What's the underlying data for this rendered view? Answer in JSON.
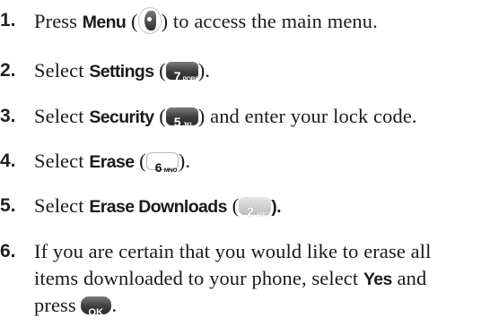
{
  "steps": [
    {
      "number": "1.",
      "before": "Press ",
      "keyword": "Menu",
      "open": " (",
      "close": ") to access the main menu.",
      "icon": "menu-key-icon"
    },
    {
      "number": "2.",
      "before": "Select ",
      "keyword": "Settings",
      "open": " (",
      "close": ").",
      "icon": "key-7-icon",
      "key_digit": "7",
      "key_letters": "PQRS"
    },
    {
      "number": "3.",
      "before": "Select ",
      "keyword": "Security",
      "open": " (",
      "close": ") and enter your lock code.",
      "icon": "key-5-icon",
      "key_digit": "5",
      "key_letters": "JKL"
    },
    {
      "number": "4.",
      "before": "Select ",
      "keyword": "Erase",
      "open": " (",
      "close": ").",
      "icon": "key-6-icon",
      "key_digit": "6",
      "key_letters": "MNO"
    },
    {
      "number": "5.",
      "before": "Select ",
      "keyword": "Erase Downloads",
      "open": " (",
      "close": ").",
      "icon": "key-2-icon",
      "key_digit": "2",
      "key_letters": "ABC"
    },
    {
      "number": "6.",
      "line1": "If you are certain that you would like to erase all",
      "line2_before": "items downloaded to your phone, select ",
      "keyword": "Yes",
      "line2_after": " and",
      "line3_before": "press ",
      "line3_after": ".",
      "icon": "ok-key-icon",
      "key_label": "OK"
    }
  ]
}
